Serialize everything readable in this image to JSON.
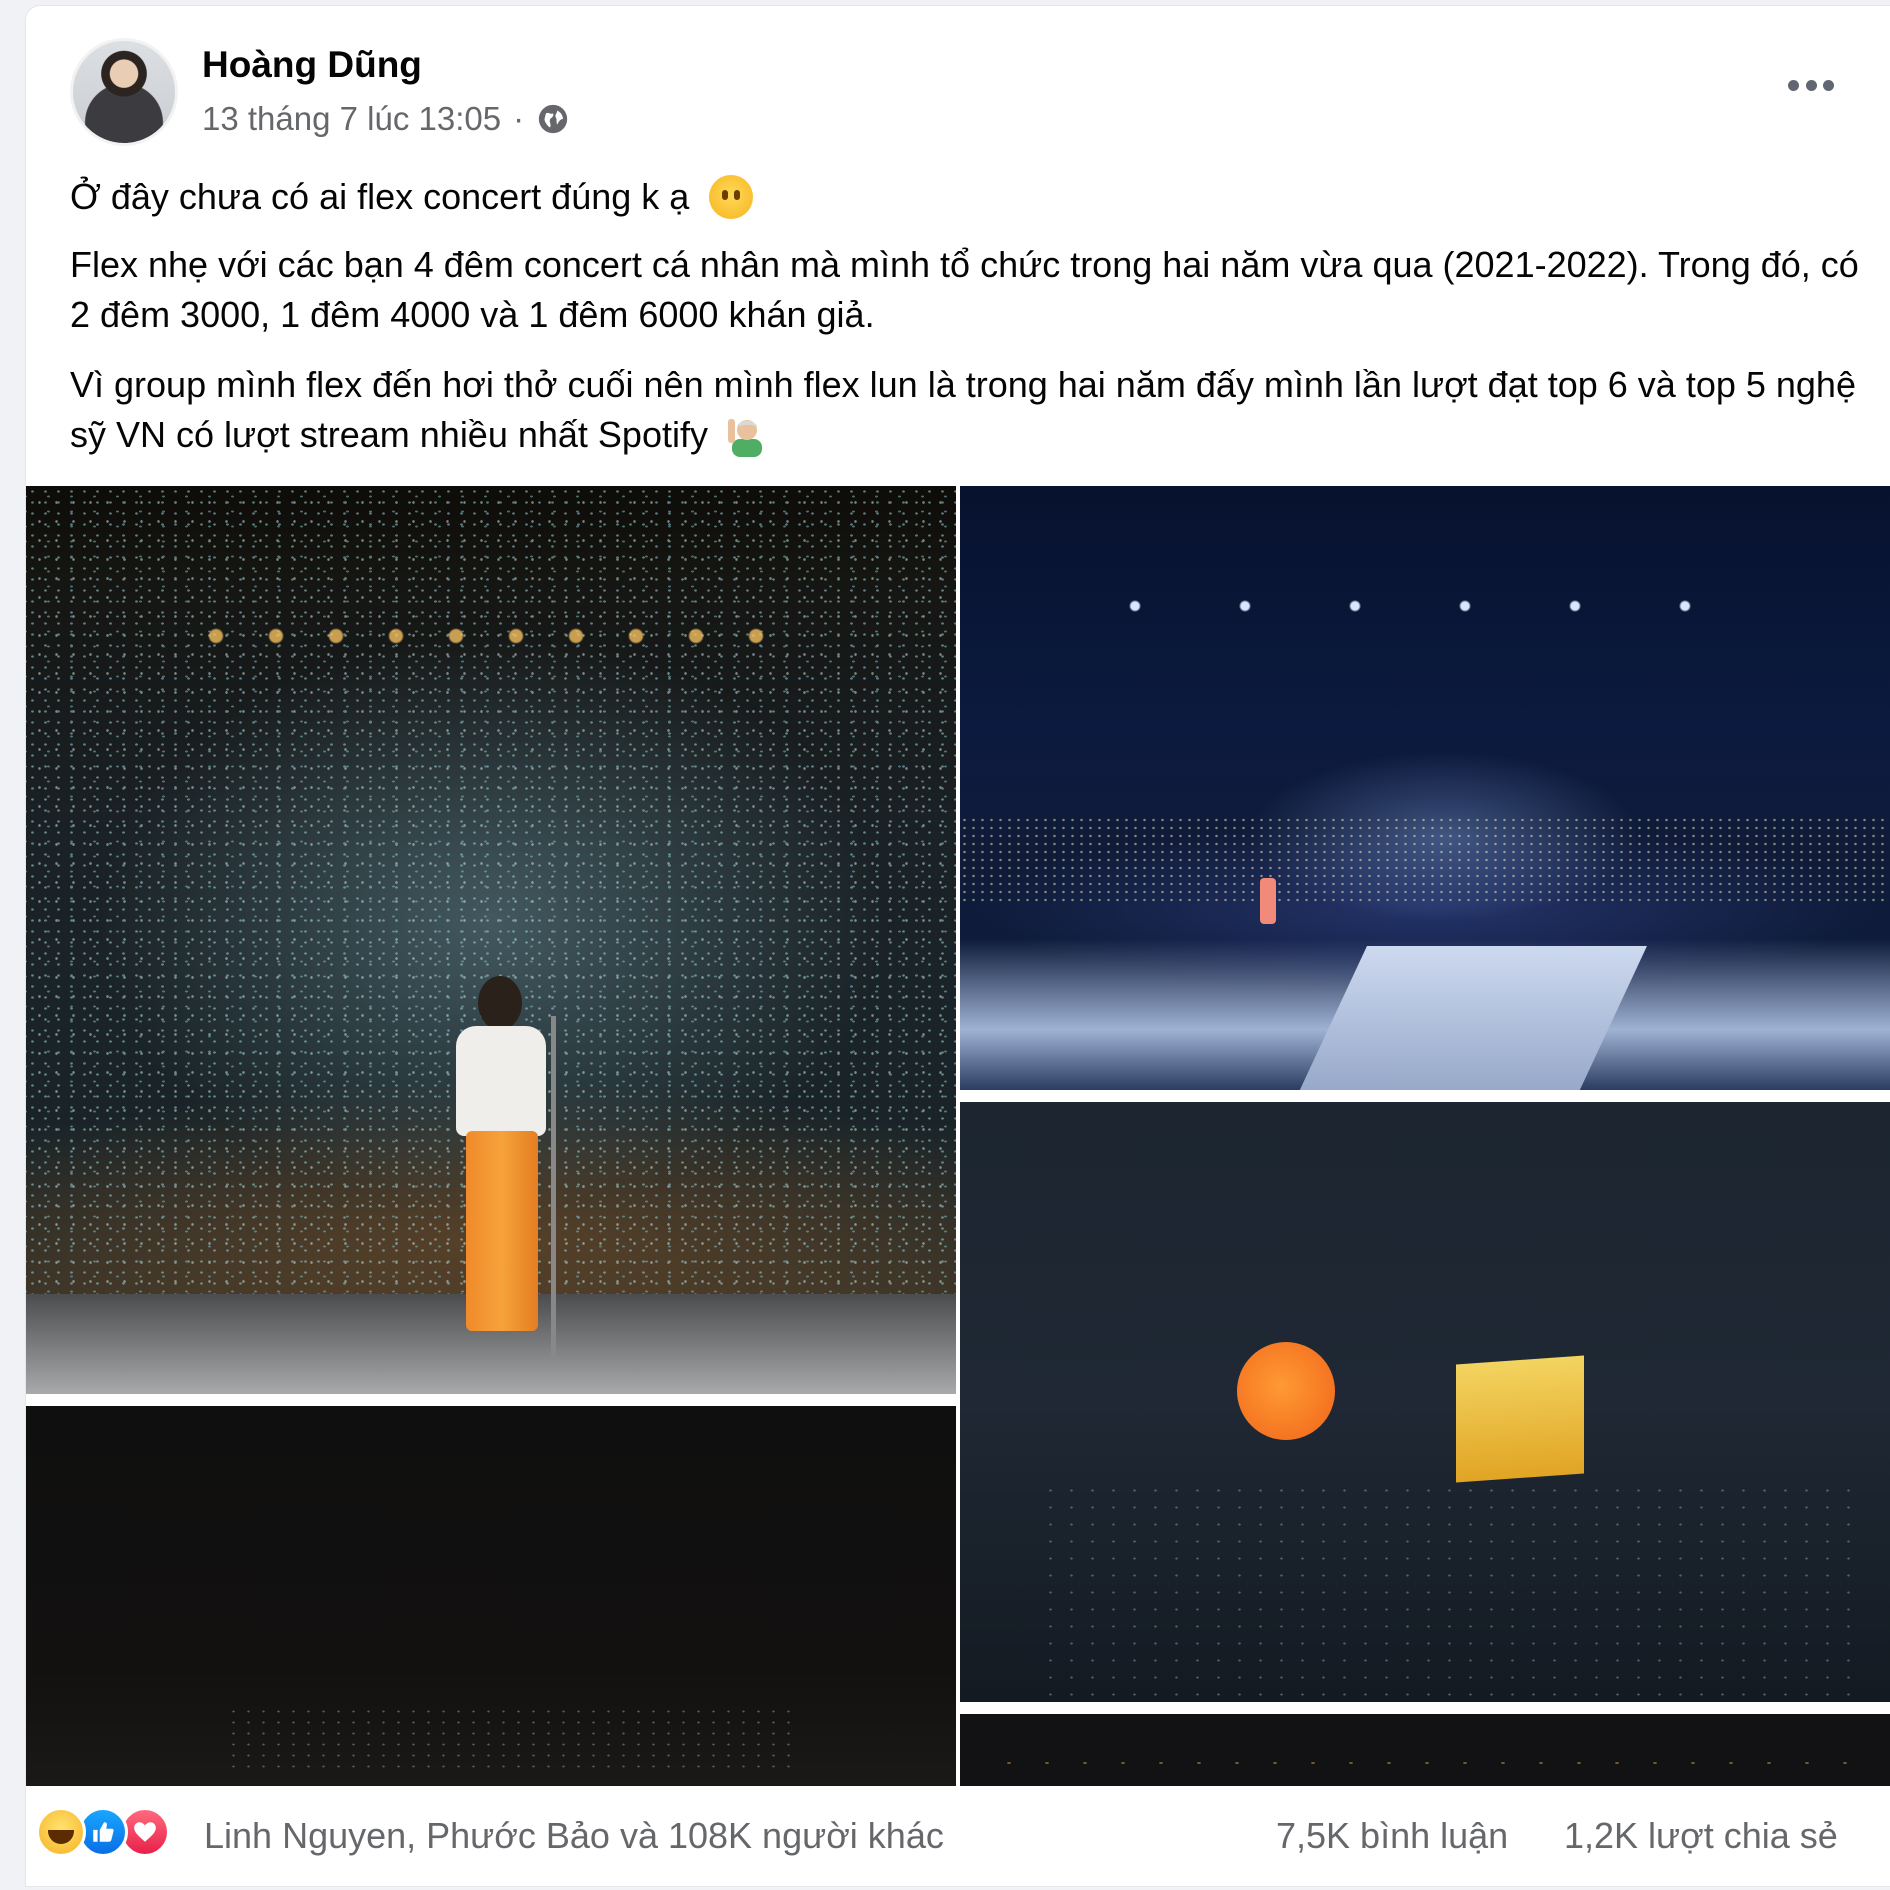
{
  "post": {
    "author": "Hoàng Dũng",
    "timestamp": "13 tháng 7 lúc 13:05",
    "separator": "·",
    "privacy_icon": "globe-icon",
    "menu_icon": "more-horizontal-icon",
    "paragraphs": [
      "Ở đây chưa có ai flex concert đúng k ạ",
      "Flex nhẹ với các bạn 4 đêm concert cá nhân mà mình tổ chức trong hai năm vừa qua (2021-2022). Trong đó, có 2 đêm 3000, 1 đêm 4000 và 1 đêm 6000 khán giả.",
      "Vì group mình flex đến hơi thở cuối nên mình flex lun là trong hai năm đấy mình lần lượt đạt top 6 và top 5 nghệ sỹ VN có lượt stream nhiều nhất Spotify"
    ],
    "emojis": [
      "face-without-mouth-emoji",
      "man-raising-hand-emoji"
    ]
  },
  "photos": [
    {
      "name": "concert-confetti-photo"
    },
    {
      "name": "concert-blue-stage-photo"
    },
    {
      "name": "concert-moon-house-photo"
    },
    {
      "name": "concert-dark-crowd-photo"
    },
    {
      "name": "concert-lights-photo"
    }
  ],
  "footer": {
    "reaction_icons": [
      "haha-icon",
      "like-icon",
      "love-icon"
    ],
    "reaction_names": "Linh Nguyen, Phước Bảo và 108K người khác",
    "comments": "7,5K bình luận",
    "shares": "1,2K lượt chia sẻ"
  },
  "colors": {
    "background": "#f0f2f5",
    "card": "#ffffff",
    "secondary_text": "#65676b",
    "primary_text": "#050505",
    "like_blue": "#0a6fe6",
    "love_red": "#e8204a"
  }
}
